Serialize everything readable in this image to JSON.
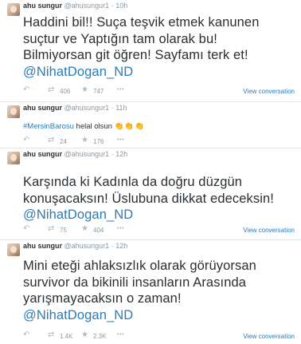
{
  "tweets": [
    {
      "name": "ahu sungur",
      "handle": "@ahusungur1",
      "time": "· 10h",
      "lines": [
        "Haddini bil!! Suça teşvik etmek kanunen",
        "suçtur ve Yaptığın tam olarak bu!",
        "Bilmiyorsan git öğren! Sayfamı terk et!"
      ],
      "mention": "@NihatDogan_ND",
      "retweets": "406",
      "favorites": "747",
      "view_label": "View conversation"
    },
    {
      "name": "ahu sungur",
      "handle": "@ahusungur1",
      "time": "· 11h",
      "hashtag": "#MersinBarosu",
      "text": " helal olsun ",
      "emoji": "👏👏👏",
      "retweets": "24",
      "favorites": "176"
    },
    {
      "name": "ahu sungur",
      "handle": "@ahusungur1",
      "time": "· 12h",
      "lines": [
        "Karşında ki Kadınla da doğru düzgün",
        "konuşacaksın! Üslubuna dikkat edeceksin!"
      ],
      "mention": "@NihatDogan_ND",
      "retweets": "75",
      "favorites": "404",
      "view_label": "View conversation"
    },
    {
      "name": "ahu sungur",
      "handle": "@ahusungur1",
      "time": "· 12h",
      "lines": [
        "Mini eteği ahlaksızlık olarak görüyorsan",
        "survivor da bikinili insanların Arasında",
        "yarışmayacaksın o zaman!"
      ],
      "mention": "@NihatDogan_ND",
      "retweets": "1.4K",
      "favorites": "2.3K",
      "view_label": "View conversation"
    }
  ]
}
